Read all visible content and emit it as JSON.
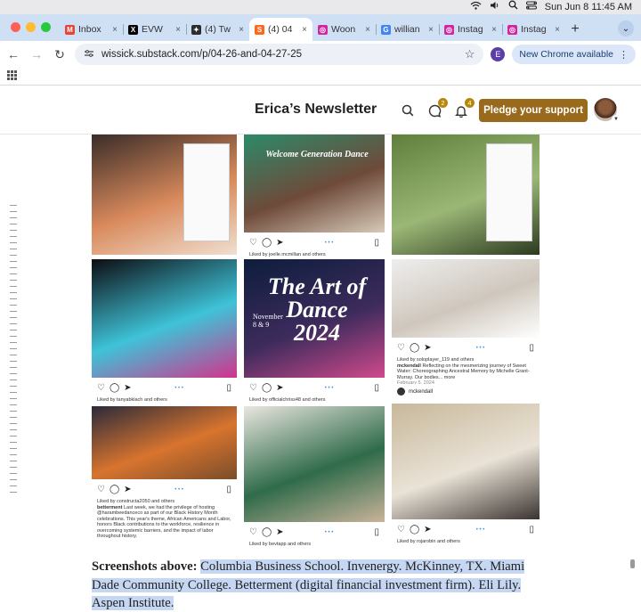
{
  "menubar": {
    "datetime": "Sun Jun 8  11:45 AM",
    "icons": [
      "wifi-icon",
      "volume-icon",
      "search-icon",
      "control-center-icon"
    ]
  },
  "tabs": [
    {
      "title": "Inbox",
      "favicon": "M",
      "color": "#ea4335"
    },
    {
      "title": "EVW",
      "favicon": "X",
      "color": "#000000"
    },
    {
      "title": "(4) Tw",
      "favicon": "✦",
      "color": "#2d2d2d"
    },
    {
      "title": "(4) 04",
      "favicon": "S",
      "color": "#ff6719",
      "active": true
    },
    {
      "title": "Woon",
      "favicon": "◎",
      "color": "#d6249f"
    },
    {
      "title": "willian",
      "favicon": "G",
      "color": "#4285f4"
    },
    {
      "title": "Instag",
      "favicon": "◎",
      "color": "#d6249f"
    },
    {
      "title": "Instag",
      "favicon": "◎",
      "color": "#d6249f"
    }
  ],
  "toolbar": {
    "url": "wissick.substack.com/p/04-26-and-04-27-25",
    "profile_letter": "E",
    "new_chrome_label": "New Chrome available"
  },
  "newsletter": {
    "title": "Erica’s Newsletter",
    "chat_badge": "2",
    "notif_badge": "4",
    "pledge_label": "Pledge your support"
  },
  "tiles": [
    {
      "id": "t1",
      "type": "photo",
      "colors": [
        "#3a2c28",
        "#d98a5c",
        "#f0e0d0"
      ],
      "inset_post": true
    },
    {
      "id": "t2",
      "type": "ig",
      "colors": [
        "#2c8a6a",
        "#6e4a3a",
        "#d7c9b8"
      ],
      "poster_text": "Welcome Generation Dance",
      "liked_by": "Liked by joelle.mcmillan and others"
    },
    {
      "id": "t3",
      "type": "photo",
      "colors": [
        "#5f7f3c",
        "#9bb776",
        "#2b3a1e"
      ],
      "inset_post": true
    },
    {
      "id": "t4",
      "type": "ig",
      "colors": [
        "#0d0d12",
        "#3ec3d8",
        "#d2338c"
      ],
      "liked_by": "Liked by tanyabklach and others"
    },
    {
      "id": "t5",
      "type": "ig",
      "colors": [
        "#0c1d3c",
        "#3d2b5c",
        "#d04a8c"
      ],
      "poster_text": "The Art of Dance 2024",
      "poster_sub": "November 8 & 9",
      "liked_by": "Liked by officialchriss48 and others"
    },
    {
      "id": "t6",
      "type": "ig",
      "colors": [
        "#eeeeee",
        "#cfc7bd",
        "#ffffff"
      ],
      "liked_by": "Liked by soloplayer_119 and others",
      "caption_user": "mckendall",
      "caption": "Reflecting on the mesmerizing journey of Sweet Water: Choreographing Ancestral Memory by Michelle Grant-Murray. Our bodies... more",
      "date": "February 5, 2024"
    },
    {
      "id": "t7",
      "type": "ig",
      "colors": [
        "#2a2a3a",
        "#d8742e",
        "#7a4d2a"
      ],
      "liked_by": "Liked by constructa2050 and others",
      "caption_user": "betterment",
      "caption": "Last week, we had the privilege of hosting @harambeedanceco as part of our Black History Month celebrations. This year's theme, African Americans and Labor, honors Black contributions to the workforce, resilience in overcoming systemic barriers, and the impact of labor throughout history."
    },
    {
      "id": "t8",
      "type": "ig",
      "colors": [
        "#eae6e0",
        "#2f6b4a",
        "#c9b39a"
      ],
      "liked_by": "Liked by bevtapp and others"
    },
    {
      "id": "t9",
      "type": "ig",
      "colors": [
        "#c8b89a",
        "#e9e2d6",
        "#3a3330"
      ],
      "account": "mckendall",
      "liked_by": "Liked by rojarobin and others"
    }
  ],
  "paragraph": {
    "label": "Screenshots above:",
    "text": "Columbia Business School. Invenergy. McKinney, TX. Miami Dade Community College. Betterment (digital financial investment firm). Eli Lily. Aspen Institute."
  }
}
